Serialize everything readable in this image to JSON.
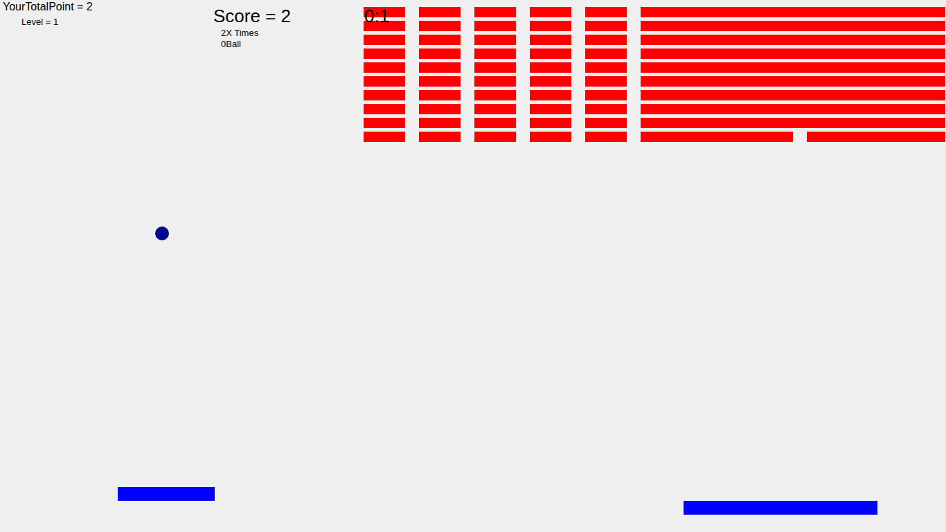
{
  "hud": {
    "total_point": "YourTotalPoint = 2",
    "level": "Level = 1",
    "score": "Score = 2",
    "multiplier": "2X Times",
    "balls": "0Ball",
    "time": "0:1"
  },
  "bricks": {
    "rows": [
      {
        "blocks": [
          {
            "present": true
          },
          {
            "present": true
          },
          {
            "present": true
          },
          {
            "present": true
          },
          {
            "present": true
          }
        ],
        "strip": [
          {
            "present": true
          },
          {
            "present": true
          },
          {
            "present": true
          },
          {
            "present": true
          },
          {
            "present": true
          },
          {
            "present": true
          },
          {
            "present": true
          },
          {
            "present": true
          },
          {
            "present": true
          },
          {
            "present": true
          },
          {
            "present": true
          },
          {
            "present": true
          },
          {
            "present": true
          },
          {
            "present": true
          },
          {
            "present": true
          },
          {
            "present": true
          },
          {
            "present": true
          },
          {
            "present": true
          },
          {
            "present": true
          },
          {
            "present": true
          },
          {
            "present": true
          },
          {
            "present": true
          }
        ]
      },
      {
        "blocks": [
          {
            "present": true
          },
          {
            "present": true
          },
          {
            "present": true
          },
          {
            "present": true
          },
          {
            "present": true
          }
        ],
        "strip": [
          {
            "present": true
          },
          {
            "present": true
          },
          {
            "present": true
          },
          {
            "present": true
          },
          {
            "present": true
          },
          {
            "present": true
          },
          {
            "present": true
          },
          {
            "present": true
          },
          {
            "present": true
          },
          {
            "present": true
          },
          {
            "present": true
          },
          {
            "present": true
          },
          {
            "present": true
          },
          {
            "present": true
          },
          {
            "present": true
          },
          {
            "present": true
          },
          {
            "present": true
          },
          {
            "present": true
          },
          {
            "present": true
          },
          {
            "present": true
          },
          {
            "present": true
          },
          {
            "present": true
          }
        ]
      },
      {
        "blocks": [
          {
            "present": true
          },
          {
            "present": true
          },
          {
            "present": true
          },
          {
            "present": true
          },
          {
            "present": true
          }
        ],
        "strip": [
          {
            "present": true
          },
          {
            "present": true
          },
          {
            "present": true
          },
          {
            "present": true
          },
          {
            "present": true
          },
          {
            "present": true
          },
          {
            "present": true
          },
          {
            "present": true
          },
          {
            "present": true
          },
          {
            "present": true
          },
          {
            "present": true
          },
          {
            "present": true
          },
          {
            "present": true
          },
          {
            "present": true
          },
          {
            "present": true
          },
          {
            "present": true
          },
          {
            "present": true
          },
          {
            "present": true
          },
          {
            "present": true
          },
          {
            "present": true
          },
          {
            "present": true
          },
          {
            "present": true
          }
        ]
      },
      {
        "blocks": [
          {
            "present": true
          },
          {
            "present": true
          },
          {
            "present": true
          },
          {
            "present": true
          },
          {
            "present": true
          }
        ],
        "strip": [
          {
            "present": true
          },
          {
            "present": true
          },
          {
            "present": true
          },
          {
            "present": true
          },
          {
            "present": true
          },
          {
            "present": true
          },
          {
            "present": true
          },
          {
            "present": true
          },
          {
            "present": true
          },
          {
            "present": true
          },
          {
            "present": true
          },
          {
            "present": true
          },
          {
            "present": true
          },
          {
            "present": true
          },
          {
            "present": true
          },
          {
            "present": true
          },
          {
            "present": true
          },
          {
            "present": true
          },
          {
            "present": true
          },
          {
            "present": true
          },
          {
            "present": true
          },
          {
            "present": true
          }
        ]
      },
      {
        "blocks": [
          {
            "present": true
          },
          {
            "present": true
          },
          {
            "present": true
          },
          {
            "present": true
          },
          {
            "present": true
          }
        ],
        "strip": [
          {
            "present": true
          },
          {
            "present": true
          },
          {
            "present": true
          },
          {
            "present": true
          },
          {
            "present": true
          },
          {
            "present": true
          },
          {
            "present": true
          },
          {
            "present": true
          },
          {
            "present": true
          },
          {
            "present": true
          },
          {
            "present": true
          },
          {
            "present": true
          },
          {
            "present": true
          },
          {
            "present": true
          },
          {
            "present": true
          },
          {
            "present": true
          },
          {
            "present": true
          },
          {
            "present": true
          },
          {
            "present": true
          },
          {
            "present": true
          },
          {
            "present": true
          },
          {
            "present": true
          }
        ]
      },
      {
        "blocks": [
          {
            "present": true
          },
          {
            "present": true
          },
          {
            "present": true
          },
          {
            "present": true
          },
          {
            "present": true
          }
        ],
        "strip": [
          {
            "present": true
          },
          {
            "present": true
          },
          {
            "present": true
          },
          {
            "present": true
          },
          {
            "present": true
          },
          {
            "present": true
          },
          {
            "present": true
          },
          {
            "present": true
          },
          {
            "present": true
          },
          {
            "present": true
          },
          {
            "present": true
          },
          {
            "present": true
          },
          {
            "present": true
          },
          {
            "present": true
          },
          {
            "present": true
          },
          {
            "present": true
          },
          {
            "present": true
          },
          {
            "present": true
          },
          {
            "present": true
          },
          {
            "present": true
          },
          {
            "present": true
          },
          {
            "present": true
          }
        ]
      },
      {
        "blocks": [
          {
            "present": true
          },
          {
            "present": true
          },
          {
            "present": true
          },
          {
            "present": true
          },
          {
            "present": true
          }
        ],
        "strip": [
          {
            "present": true
          },
          {
            "present": true
          },
          {
            "present": true
          },
          {
            "present": true
          },
          {
            "present": true
          },
          {
            "present": true
          },
          {
            "present": true
          },
          {
            "present": true
          },
          {
            "present": true
          },
          {
            "present": true
          },
          {
            "present": true
          },
          {
            "present": true
          },
          {
            "present": true
          },
          {
            "present": true
          },
          {
            "present": true
          },
          {
            "present": true
          },
          {
            "present": true
          },
          {
            "present": true
          },
          {
            "present": true
          },
          {
            "present": true
          },
          {
            "present": true
          },
          {
            "present": true
          }
        ]
      },
      {
        "blocks": [
          {
            "present": true
          },
          {
            "present": true
          },
          {
            "present": true
          },
          {
            "present": true
          },
          {
            "present": true
          }
        ],
        "strip": [
          {
            "present": true
          },
          {
            "present": true
          },
          {
            "present": true
          },
          {
            "present": true
          },
          {
            "present": true
          },
          {
            "present": true
          },
          {
            "present": true
          },
          {
            "present": true
          },
          {
            "present": true
          },
          {
            "present": true
          },
          {
            "present": true
          },
          {
            "present": true
          },
          {
            "present": true
          },
          {
            "present": true
          },
          {
            "present": true
          },
          {
            "present": true
          },
          {
            "present": true
          },
          {
            "present": true
          },
          {
            "present": true
          },
          {
            "present": true
          },
          {
            "present": true
          },
          {
            "present": true
          }
        ]
      },
      {
        "blocks": [
          {
            "present": true
          },
          {
            "present": true
          },
          {
            "present": true
          },
          {
            "present": true
          },
          {
            "present": true
          }
        ],
        "strip": [
          {
            "present": true
          },
          {
            "present": true
          },
          {
            "present": true
          },
          {
            "present": true
          },
          {
            "present": true
          },
          {
            "present": true
          },
          {
            "present": true
          },
          {
            "present": true
          },
          {
            "present": true
          },
          {
            "present": true
          },
          {
            "present": true
          },
          {
            "present": true
          },
          {
            "present": true
          },
          {
            "present": true
          },
          {
            "present": true
          },
          {
            "present": true
          },
          {
            "present": true
          },
          {
            "present": true
          },
          {
            "present": true
          },
          {
            "present": true
          },
          {
            "present": true
          },
          {
            "present": true
          }
        ]
      },
      {
        "blocks": [
          {
            "present": true
          },
          {
            "present": true
          },
          {
            "present": true
          },
          {
            "present": true
          },
          {
            "present": true
          }
        ],
        "strip": [
          {
            "present": true
          },
          {
            "present": true
          },
          {
            "present": true
          },
          {
            "present": true
          },
          {
            "present": true
          },
          {
            "present": true
          },
          {
            "present": true
          },
          {
            "present": true
          },
          {
            "present": true
          },
          {
            "present": true
          },
          {
            "present": true
          },
          {
            "present": false
          },
          {
            "present": true
          },
          {
            "present": true
          },
          {
            "present": true
          },
          {
            "present": true
          },
          {
            "present": true
          },
          {
            "present": true
          },
          {
            "present": true
          },
          {
            "present": true
          },
          {
            "present": true
          },
          {
            "present": true
          }
        ]
      }
    ]
  }
}
